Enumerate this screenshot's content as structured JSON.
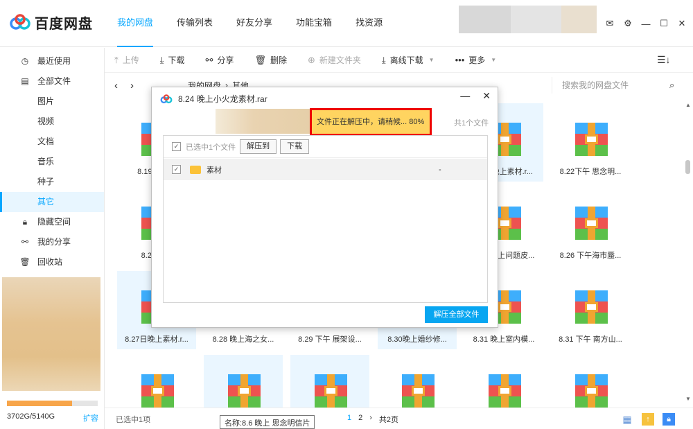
{
  "app": {
    "name": "百度网盘"
  },
  "nav": [
    {
      "label": "我的网盘",
      "active": true
    },
    {
      "label": "传输列表",
      "active": false
    },
    {
      "label": "好友分享",
      "active": false
    },
    {
      "label": "功能宝箱",
      "active": false
    },
    {
      "label": "找资源",
      "active": false
    }
  ],
  "window_icons": [
    "mail-icon",
    "settings-icon",
    "minimize-icon",
    "maximize-icon",
    "close-icon"
  ],
  "sidebar": {
    "items": [
      {
        "label": "最近使用",
        "icon": "clock-icon",
        "sub": false,
        "active": false
      },
      {
        "label": "全部文件",
        "icon": "file-icon",
        "sub": false,
        "active": false
      },
      {
        "label": "图片",
        "sub": true,
        "active": false
      },
      {
        "label": "视频",
        "sub": true,
        "active": false
      },
      {
        "label": "文档",
        "sub": true,
        "active": false
      },
      {
        "label": "音乐",
        "sub": true,
        "active": false
      },
      {
        "label": "种子",
        "sub": true,
        "active": false
      },
      {
        "label": "其它",
        "sub": true,
        "active": true
      },
      {
        "label": "隐藏空间",
        "icon": "lock-icon",
        "sub": false,
        "active": false
      },
      {
        "label": "我的分享",
        "icon": "share-icon",
        "sub": false,
        "active": false
      },
      {
        "label": "回收站",
        "icon": "trash-icon",
        "sub": false,
        "active": false
      }
    ],
    "quota": {
      "text": "3702G/5140G",
      "used": 3702,
      "total": 5140,
      "expand": "扩容"
    }
  },
  "toolbar": [
    {
      "label": "上传",
      "icon": "upload-icon",
      "disabled": true,
      "caret": false
    },
    {
      "label": "下载",
      "icon": "download-icon",
      "disabled": false,
      "caret": false
    },
    {
      "label": "分享",
      "icon": "share-icon",
      "disabled": false,
      "caret": false
    },
    {
      "label": "删除",
      "icon": "trash-icon",
      "disabled": false,
      "caret": false
    },
    {
      "label": "新建文件夹",
      "icon": "new-folder-icon",
      "disabled": true,
      "caret": false
    },
    {
      "label": "离线下载",
      "icon": "offline-download-icon",
      "disabled": false,
      "caret": true
    },
    {
      "label": "更多",
      "icon": "more-icon",
      "disabled": false,
      "caret": true
    }
  ],
  "breadcrumb": {
    "items": [
      "我的网盘",
      "其他"
    ]
  },
  "search": {
    "placeholder": "搜索我的网盘文件"
  },
  "files": [
    {
      "name": "8.19 晚上...",
      "selected": false
    },
    {
      "name": "",
      "selected": false
    },
    {
      "name": "",
      "selected": false
    },
    {
      "name": "",
      "selected": false
    },
    {
      "name": "8.22 晚上素材.r...",
      "selected": true
    },
    {
      "name": "8.22下午 思念明...",
      "selected": false
    },
    {
      "name": "8.23 晚...",
      "selected": false
    },
    {
      "name": "",
      "selected": false
    },
    {
      "name": "",
      "selected": false
    },
    {
      "name": "",
      "selected": false
    },
    {
      "name": "8.25 晚上问题皮...",
      "selected": false
    },
    {
      "name": "8.26 下午海市蜃...",
      "selected": false
    },
    {
      "name": "8.27日晚上素材.r...",
      "selected": true
    },
    {
      "name": "8.28 晚上海之女...",
      "selected": false
    },
    {
      "name": "8.29 下午 展架设...",
      "selected": false
    },
    {
      "name": "8.30晚上婚纱修...",
      "selected": true
    },
    {
      "name": "8.31 晚上室内模...",
      "selected": false
    },
    {
      "name": "8.31 下午 南方山...",
      "selected": false
    },
    {
      "name": "",
      "selected": false
    },
    {
      "name": "",
      "selected": true
    },
    {
      "name": "",
      "selected": true
    },
    {
      "name": "",
      "selected": false
    },
    {
      "name": "",
      "selected": false
    },
    {
      "name": "",
      "selected": false
    }
  ],
  "footer": {
    "selected": "已选中1项",
    "tooltip": "名称:8.6 晚上 思念明信片",
    "pages": [
      "1",
      "2"
    ],
    "next": "›",
    "total": "共2页"
  },
  "dialog": {
    "title": "8.24 晚上小火龙素材.rar",
    "progress_text": "文件正在解压中，请稍候... 80%",
    "progress_percent": 80,
    "file_count": "共1个文件",
    "selected_label": "已选中1个文件",
    "extract_to": "解压到",
    "download": "下载",
    "rows": [
      {
        "name": "素材",
        "size": "-"
      }
    ],
    "extract_all": "解压全部文件"
  },
  "colors": {
    "accent": "#06a7ff",
    "highlight": "#ffd460",
    "border_red": "#e00000"
  }
}
